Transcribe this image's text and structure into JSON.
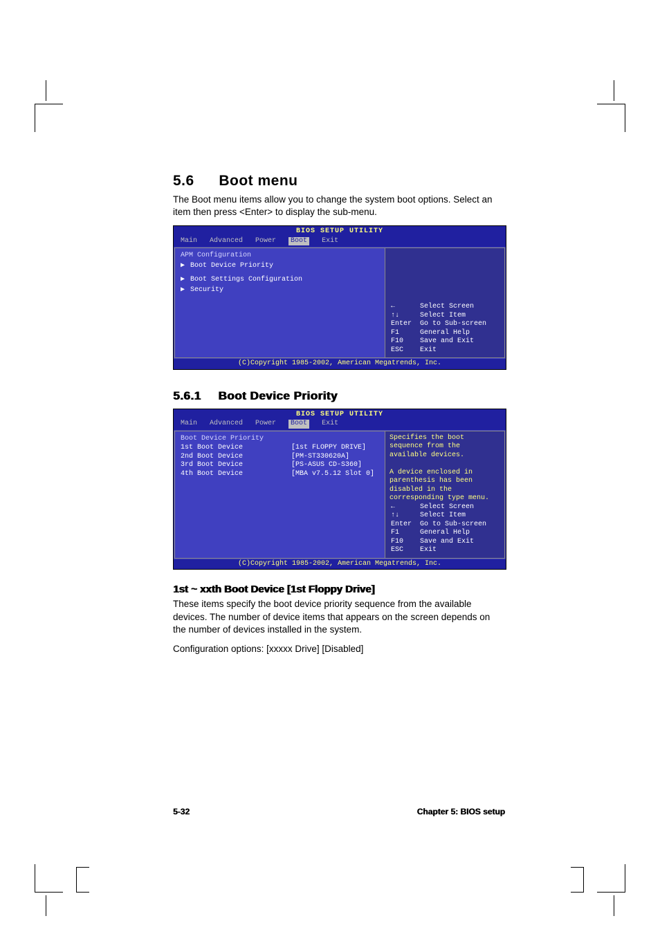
{
  "section": {
    "number": "5.6",
    "title": "Boot menu",
    "intro": "The Boot menu items allow you to change the system boot options. Select an item then press <Enter> to display the sub-menu."
  },
  "bios1": {
    "setup_title": "BIOS SETUP UTILITY",
    "tabs": {
      "main": "Main",
      "advanced": "Advanced",
      "power": "Power",
      "boot": "Boot",
      "exit": "Exit"
    },
    "header": "APM Configuration",
    "items": {
      "a": "Boot Device Priority",
      "b": "Boot Settings Configuration",
      "c": "Security"
    },
    "help": {
      "r1k": "←",
      "r1d": "Select Screen",
      "r2k": "↑↓",
      "r2d": "Select Item",
      "r3k": "Enter",
      "r3d": "Go to Sub-screen",
      "r4k": "F1",
      "r4d": "General Help",
      "r5k": "F10",
      "r5d": "Save and Exit",
      "r6k": "ESC",
      "r6d": "Exit"
    },
    "copyright": "(C)Copyright 1985-2002, American Megatrends, Inc."
  },
  "subsection": {
    "number": "5.6.1",
    "title": "Boot Device Priority"
  },
  "bios2": {
    "setup_title": "BIOS SETUP UTILITY",
    "tabs": {
      "main": "Main",
      "advanced": "Advanced",
      "power": "Power",
      "boot": "Boot",
      "exit": "Exit"
    },
    "header": "Boot Device Priority",
    "rows": {
      "r1l": "1st Boot Device",
      "r1v": "[1st FLOPPY DRIVE]",
      "r2l": "2nd Boot Device",
      "r2v": "[PM-ST330620A]",
      "r3l": "3rd Boot Device",
      "r3v": "[PS-ASUS CD-S360]",
      "r4l": "4th Boot Device",
      "r4v": "[MBA v7.5.12 Slot 0]"
    },
    "desc": "Specifies the boot sequence from the available devices.\n\nA device enclosed in parenthesis has been disabled in the corresponding type menu.",
    "help": {
      "r1k": "←",
      "r1d": "Select Screen",
      "r2k": "↑↓",
      "r2d": "Select Item",
      "r3k": "Enter",
      "r3d": "Go to Sub-screen",
      "r4k": "F1",
      "r4d": "General Help",
      "r5k": "F10",
      "r5d": "Save and Exit",
      "r6k": "ESC",
      "r6d": "Exit"
    },
    "copyright": "(C)Copyright 1985-2002, American Megatrends, Inc."
  },
  "option": {
    "title": "1st ~ xxth Boot Device [1st Floppy Drive]",
    "p1": "These items specify the boot device priority sequence from the available devices. The number of device items that appears on the screen depends on the number of devices installed in the system.",
    "p2": "Configuration options: [xxxxx Drive] [Disabled]"
  },
  "footer": {
    "page": "5-32",
    "chapter": "Chapter 5: BIOS setup"
  }
}
